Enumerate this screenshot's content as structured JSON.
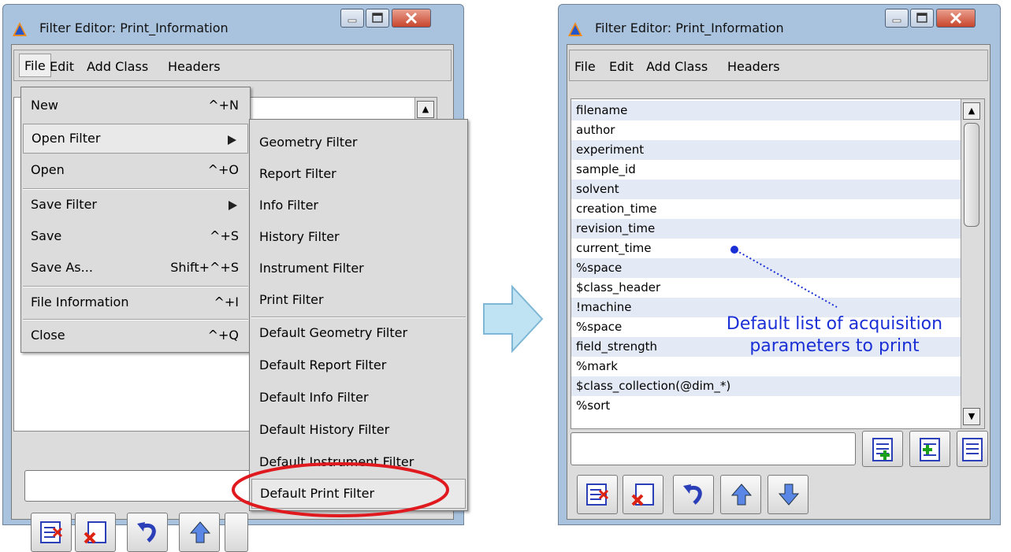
{
  "left_window": {
    "title": "Filter Editor: Print_Information",
    "menu": [
      "File",
      "Edit",
      "Add Class",
      "Headers"
    ],
    "file_menu": [
      {
        "label": "New",
        "shortcut": "^+N"
      },
      {
        "label": "Open Filter",
        "shortcut": ""
      },
      {
        "label": "Open",
        "shortcut": "^+O"
      },
      {
        "label": "Save Filter",
        "shortcut": ""
      },
      {
        "label": "Save",
        "shortcut": "^+S"
      },
      {
        "label": "Save As...",
        "shortcut": "Shift+^+S"
      },
      {
        "label": "File Information",
        "shortcut": "^+I"
      },
      {
        "label": "Close",
        "shortcut": "^+Q"
      }
    ],
    "open_filter_submenu": [
      "Geometry Filter",
      "Report Filter",
      "Info Filter",
      "History Filter",
      "Instrument Filter",
      "Print Filter",
      "Default Geometry Filter",
      "Default Report Filter",
      "Default Info Filter",
      "Default History Filter",
      "Default Instrument Filter",
      "Default Print Filter"
    ]
  },
  "right_window": {
    "title": "Filter Editor: Print_Information",
    "menu": [
      "File",
      "Edit",
      "Add Class",
      "Headers"
    ],
    "items": [
      "filename",
      "author",
      "experiment",
      "sample_id",
      "solvent",
      "creation_time",
      "revision_time",
      "current_time",
      "%space",
      "$class_header",
      "!machine",
      "%space",
      "field_strength",
      "%mark",
      "$class_collection(@dim_*)",
      "%sort"
    ]
  },
  "annotation": {
    "line1": "Default list of acquisition",
    "line2": "parameters to print"
  },
  "colors": {
    "highlight_ring": "#e0191f",
    "annotation": "#1a2fd6",
    "flow_arrow": "#bfe3f2"
  }
}
